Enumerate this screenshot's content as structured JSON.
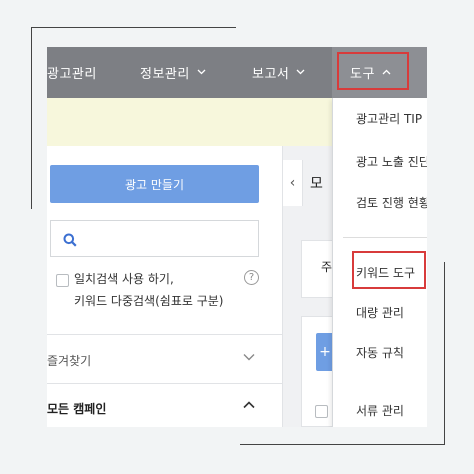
{
  "nav": {
    "items": [
      {
        "label": "광고관리"
      },
      {
        "label": "정보관리",
        "chevron": "chevron-down-icon"
      },
      {
        "label": "보고서",
        "chevron": "chevron-down-icon"
      },
      {
        "label": "도구",
        "chevron": "chevron-up-icon",
        "active": true
      }
    ]
  },
  "sidebar": {
    "create_button": "광고 만들기",
    "search_placeholder": "",
    "option_line1": "일치검색 사용 하기,",
    "option_line2": "키워드 다중검색(쉼표로 구분)",
    "help": "?",
    "favorites": "즐겨찾기",
    "all_campaigns": "모든 캠페인"
  },
  "main": {
    "collapse": "‹",
    "title": "모",
    "box_text": "주",
    "plus": "+"
  },
  "dropdown": {
    "items": [
      {
        "label": "광고관리 TIP"
      },
      {
        "label": "광고 노출 진단"
      },
      {
        "label": "검토 진행 현황"
      },
      {
        "label": "키워드 도구",
        "highlighted": true
      },
      {
        "label": "대량 관리"
      },
      {
        "label": "자동 규칙"
      },
      {
        "label": "서류 관리"
      }
    ]
  },
  "colors": {
    "nav_bg": "#7d7f84",
    "primary_button": "#6f9ee3",
    "highlight_box": "#d83b3b",
    "banner_bg": "#f7f7dc"
  }
}
